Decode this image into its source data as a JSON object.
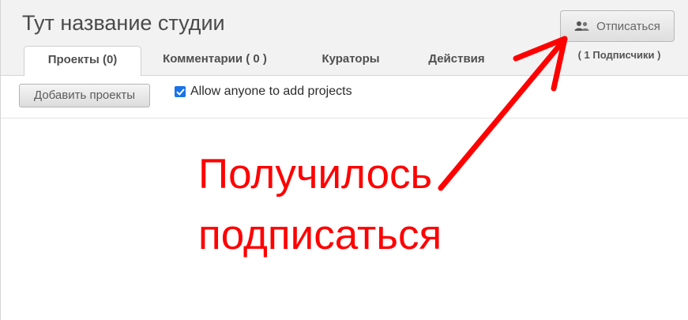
{
  "studio": {
    "title": "Тут название студии"
  },
  "tabs": [
    {
      "label": "Проекты (0)",
      "active": true
    },
    {
      "label": "Комментарии ( 0 )",
      "active": false
    },
    {
      "label": "Кураторы",
      "active": false
    },
    {
      "label": "Действия",
      "active": false
    }
  ],
  "follow": {
    "button_label": "Отписаться",
    "button_icon": "users-icon",
    "followers_label": "( 1 Подписчики )"
  },
  "toolbar": {
    "add_projects_label": "Добавить проекты",
    "allow_anyone_label": "Allow anyone to add projects",
    "allow_anyone_checked": true
  },
  "annotation": {
    "line1": "Получилось",
    "line2": "подписаться",
    "color": "#ff0000"
  }
}
